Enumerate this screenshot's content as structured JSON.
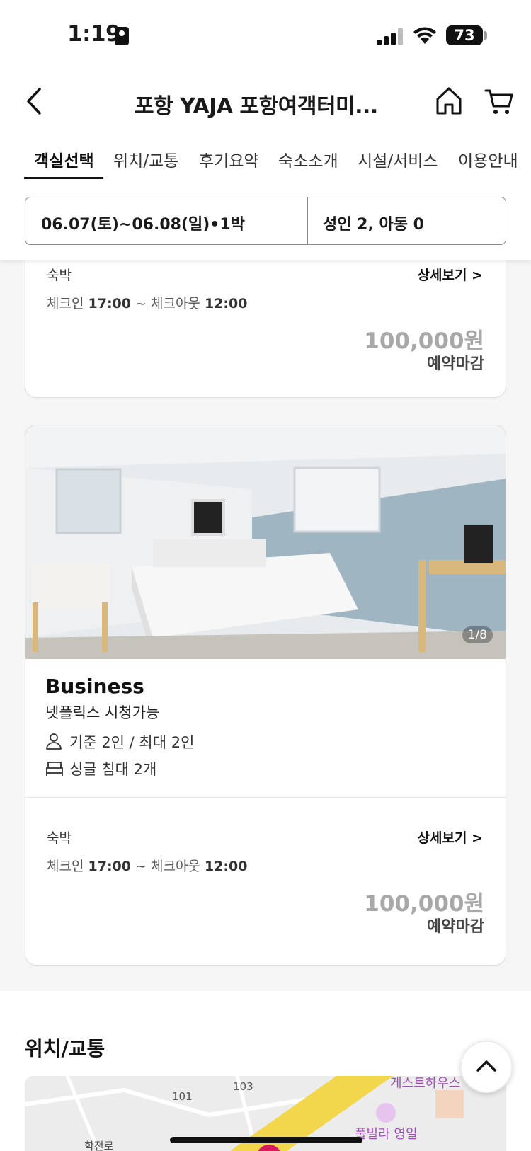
{
  "status": {
    "time": "1:19",
    "battery": "73"
  },
  "header": {
    "title": "포항 YAJA 포항여객터미..."
  },
  "tabs": [
    {
      "label": "객실선택"
    },
    {
      "label": "위치/교통"
    },
    {
      "label": "후기요약"
    },
    {
      "label": "숙소소개"
    },
    {
      "label": "시설/서비스"
    },
    {
      "label": "이용안내"
    }
  ],
  "search": {
    "dates": "06.07(토)~06.08(일)•1박",
    "guests": "성인 2, 아동 0"
  },
  "rate_top": {
    "type": "숙박",
    "detail": "상세보기 >",
    "checkin_label": "체크인",
    "checkin_time": "17:00",
    "checkout_label": "~ 체크아웃",
    "checkout_time": "12:00",
    "price": "100,000원",
    "status": "예약마감"
  },
  "room": {
    "photo_counter": "1/8",
    "name": "Business",
    "description": "넷플릭스 시청가능",
    "occupancy": "기준 2인 / 최대 2인",
    "bed": "싱글 침대 2개",
    "rate": {
      "type": "숙박",
      "detail": "상세보기 >",
      "checkin_label": "체크인",
      "checkin_time": "17:00",
      "checkout_label": "~ 체크아웃",
      "checkout_time": "12:00",
      "price": "100,000원",
      "status": "예약마감"
    }
  },
  "location": {
    "title": "위치/교통",
    "map_labels": [
      "101",
      "103",
      "학전로"
    ],
    "map_places": [
      "게스트하우스",
      "풀빌라 영일"
    ]
  },
  "colors": {
    "price_grey": "#a8a8a8",
    "map_road": "#f2d64b",
    "map_poi": "#9c4fb5"
  }
}
